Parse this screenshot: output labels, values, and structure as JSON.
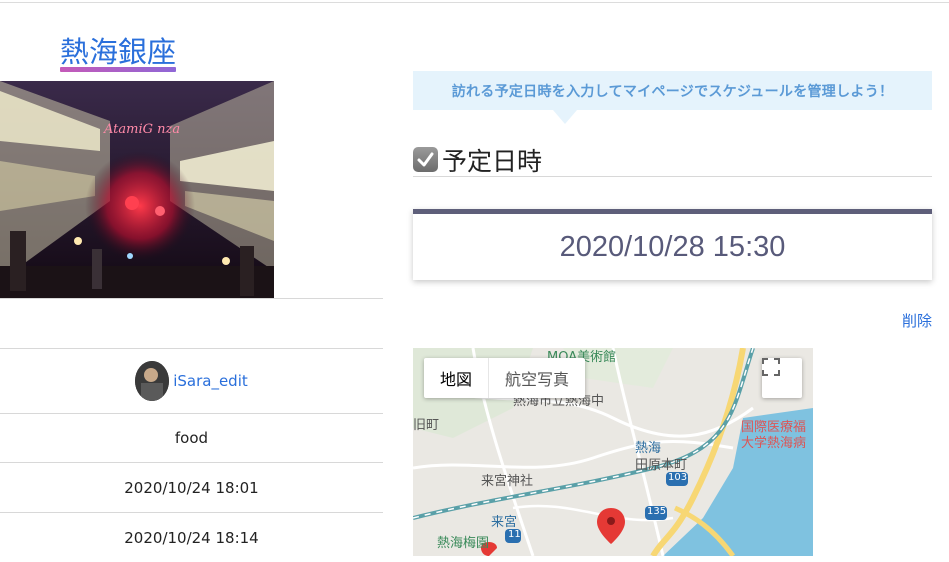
{
  "spot": {
    "title": "熱海銀座",
    "photo_sign_text": "AtamiG nza"
  },
  "info_table": {
    "user_name": "iSara_edit",
    "category": "food",
    "created_at": "2020/10/24 18:01",
    "updated_at": "2020/10/24 18:14"
  },
  "schedule": {
    "hint": "訪れる予定日時を入力してマイページでスケジュールを管理しよう！",
    "heading": "予定日時",
    "datetime": "2020/10/28 15:30",
    "delete_label": "削除"
  },
  "map": {
    "type_map_label": "地図",
    "type_satellite_label": "航空写真",
    "labels": {
      "moa": "MOA美術館",
      "school": "熱海市立熱海中",
      "town": "旧町",
      "atami_station": "熱海",
      "tawaramoto": "田原本町",
      "hospital1": "国際医療福",
      "hospital2": "大学熱海病",
      "kinomiya_shrine": "来宮神社",
      "kinomiya_station": "来宮",
      "baien": "熱海梅園",
      "route103": "103",
      "route135": "135",
      "route11": "11"
    },
    "colors": {
      "water": "#7fc2e0",
      "road_main": "#f7d774",
      "rail": "#5aa0a8",
      "pin": "#e53935"
    }
  }
}
